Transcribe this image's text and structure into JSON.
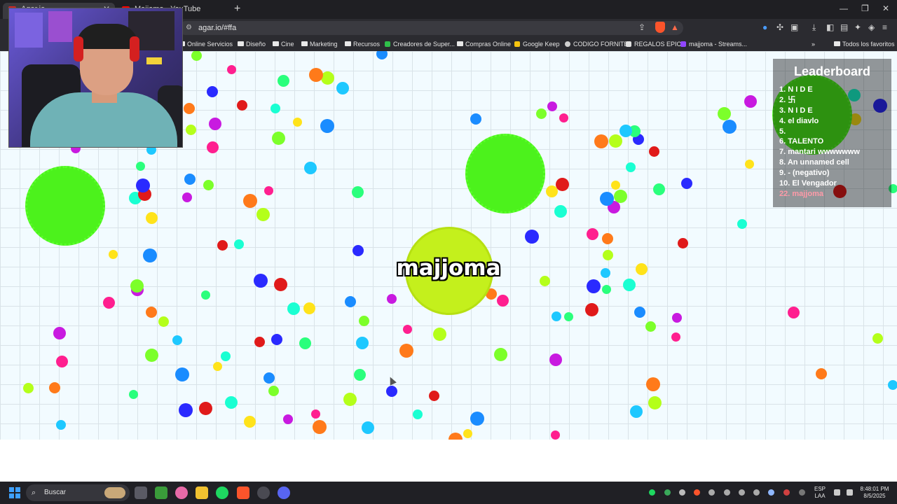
{
  "browser": {
    "tabs": [
      {
        "title": "Agar.io",
        "active": true,
        "favicon_color": "#d02828"
      },
      {
        "title": "Majjoma - YouTube",
        "active": false,
        "favicon_color": "#ff0000"
      }
    ],
    "url": "agar.io/#ffa",
    "bookmarks": [
      {
        "label": "Online Servicios",
        "icon": "folder-icon"
      },
      {
        "label": "Diseño",
        "icon": "folder-icon"
      },
      {
        "label": "Cine",
        "icon": "folder-icon"
      },
      {
        "label": "Marketing",
        "icon": "folder-icon"
      },
      {
        "label": "Recursos",
        "icon": "folder-icon"
      },
      {
        "label": "Creadores de Super...",
        "icon": "site-icon"
      },
      {
        "label": "Compras Online",
        "icon": "folder-icon"
      },
      {
        "label": "Google Keep",
        "icon": "keep-icon"
      },
      {
        "label": "CODIGO FORNITE",
        "icon": "link-icon"
      },
      {
        "label": "REGALOS EPIC",
        "icon": "epic-icon"
      },
      {
        "label": "majjoma - Streams...",
        "icon": "twitch-icon"
      }
    ],
    "all_bookmarks_label": "Todos los favoritos"
  },
  "game": {
    "player_name": "majjoma",
    "leaderboard_title": "Leaderboard",
    "leaderboard": [
      "1. N I D E",
      "2. 卐",
      "3. N I D E",
      "4. el diavlo",
      "5.",
      "6. TALENTO",
      "7. mantari wwwwwww",
      "8. An unnamed cell",
      "9. - (negativo)",
      "10. El Vengador",
      "22. majjoma"
    ],
    "own_rank_index": 10
  },
  "taskbar": {
    "search_placeholder": "Buscar",
    "language": "ESP",
    "keyboard": "LAA",
    "time": "8:48:01 PM",
    "date": "8/5/2025"
  },
  "colors": {
    "virus": "#4cf21c",
    "player_cell": "#c4f01c",
    "grid_background": "#f2fbff"
  }
}
